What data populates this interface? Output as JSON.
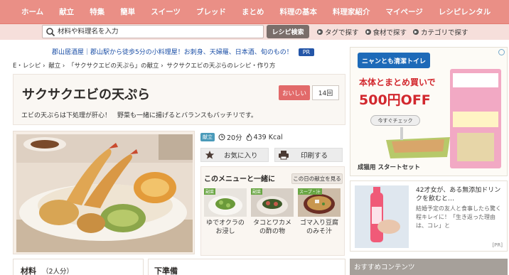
{
  "nav": {
    "items": [
      "ホーム",
      "献立",
      "特集",
      "簡単",
      "スイーツ",
      "ブレッド",
      "まとめ",
      "料理の基本",
      "料理家紹介",
      "マイページ",
      "レシピレンタル"
    ]
  },
  "search": {
    "placeholder": "材料や料理名を入力",
    "button_label": "レシピ検索",
    "quick_links": [
      "タグで探す",
      "食材で探す",
      "カテゴリで探す"
    ]
  },
  "ad_text": {
    "text": "郡山居酒屋｜郡山駅から徒歩5分の小料理屋！お刺身、天婦羅、日本酒、旬のもの！",
    "badge": "PR"
  },
  "breadcrumb": [
    "E・レシピ",
    "›",
    "献立",
    "›",
    "「サクサクエビの天ぷら」の献立",
    "›",
    "サクサクエビの天ぷらのレシピ・作り方"
  ],
  "recipe": {
    "title": "サクサクエビの天ぷら",
    "description": "エビの天ぷらは下処理が肝心！　野菜も一緒に揚げるとバランスもバッチリです。",
    "oishii_label": "おいしい",
    "oishii_count": "14回",
    "kondate_badge": "献立",
    "time": "20分",
    "calories": "439 Kcal",
    "favorite_label": "お気に入り",
    "print_label": "印刷する"
  },
  "with_menu": {
    "heading": "このメニューと一緒に",
    "today_label": "この日の献立を見る",
    "items": [
      {
        "tag": "副菜",
        "name": "ゆでオクラのお浸し"
      },
      {
        "tag": "副菜",
        "name": "タコとワカメの酢の物"
      },
      {
        "tag": "スープ・汁",
        "name": "ゴマ入り豆腐のみそ汁"
      }
    ]
  },
  "sections": {
    "ingredients_label": "材料",
    "servings": "（2人分）",
    "prep_label": "下準備"
  },
  "right_ad": {
    "brand": "ニャンとも清潔トイレ",
    "line1": "本体とまとめ買いで",
    "line2": "500円OFF",
    "check_label": "今すぐチェック",
    "footer": "成猫用 スタートセット"
  },
  "right_ad2": {
    "headline": "42才女が、ある無添加ドリンクを飲むと…",
    "body": "結婚予定の友人と食事したら驚く程キレイに！「生き返った理由は、コレ」と",
    "pr": "[PR]"
  },
  "recommended": {
    "label": "おすすめコンテンツ"
  },
  "colors": {
    "nav_bg": "#ea8f86",
    "search_bg": "#f6dfdb",
    "accent_red": "#e26a6a",
    "ad_red": "#d2282e",
    "link_blue": "#1a4ea6"
  }
}
